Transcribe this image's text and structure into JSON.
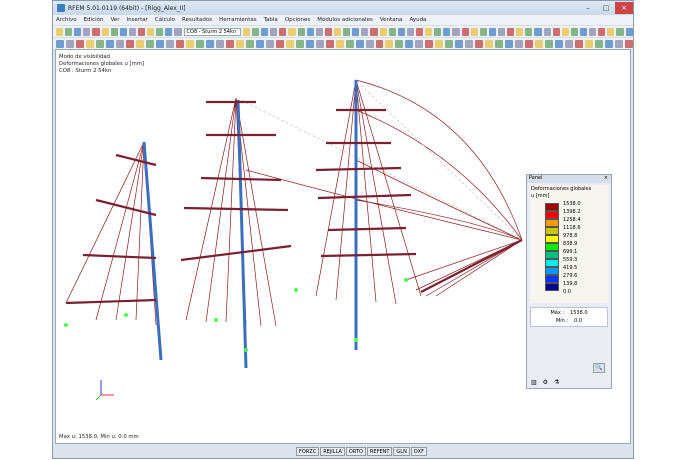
{
  "window": {
    "title": "RFEM 5.01.0119 (64bit) - [Rigg_Alex_II]",
    "controls": [
      "–",
      "□",
      "×"
    ]
  },
  "menu": [
    "Archivo",
    "Edición",
    "Ver",
    "Insertar",
    "Cálculo",
    "Resultados",
    "Herramientas",
    "Tabla",
    "Opciones",
    "Módulos adicionales",
    "Ventana",
    "Ayuda"
  ],
  "toolbar": {
    "combo": "CO8 - Sturm 2 54kn"
  },
  "info": [
    "Modo de visibilidad",
    "Deformaciones globales u [mm]",
    "CO8 : Sturm 2 54kn"
  ],
  "bottom_info": "Max u: 1538.0, Min u: 0.0 mm",
  "panel": {
    "title": "Panel",
    "close": "×",
    "legend_title": "Deformaciones globales",
    "legend_unit": "u [mm]",
    "values": [
      "1538.0",
      "1398.2",
      "1258.4",
      "1118.6",
      "978.8",
      "838.9",
      "699.1",
      "559.3",
      "419.5",
      "279.6",
      "139.8",
      "0.0"
    ],
    "colors": [
      "#a00000",
      "#f00000",
      "#ff9900",
      "#c8c800",
      "#ffff00",
      "#00ee00",
      "#00c080",
      "#00eeee",
      "#0099ff",
      "#0033ff",
      "#0000cc",
      "#00008b"
    ],
    "max_label": "Máx :",
    "max": "1538.0",
    "min_label": "Mín :",
    "min": "0.0"
  },
  "status": [
    "FORZC",
    "REJILLA",
    "ORTO",
    "REFENT",
    "GLN",
    "DXF"
  ]
}
